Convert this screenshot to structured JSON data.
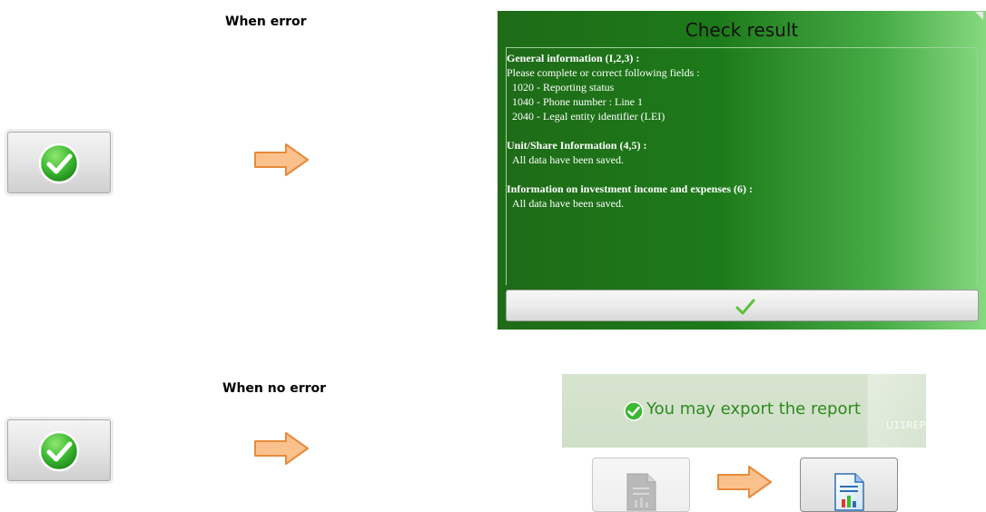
{
  "error_case": {
    "heading": "When error"
  },
  "no_error_case": {
    "heading": "When no error"
  },
  "check_result_dialog": {
    "title": "Check result",
    "sections": [
      {
        "title": "General information (I,2,3) :",
        "intro": "Please complete or correct following fields :",
        "items": [
          "1020 - Reporting status",
          "1040 - Phone number : Line 1",
          "2040 - Legal entity identifier (LEI)"
        ]
      },
      {
        "title": "Unit/Share Information (4,5) :",
        "items": [
          "All data have been saved."
        ]
      },
      {
        "title": "Information on investment income and expenses (6) :",
        "items": [
          "All data have been saved."
        ]
      }
    ]
  },
  "export_panel": {
    "message": "You may export the report",
    "ghost_label": "U11REP"
  },
  "icons": {
    "check_button": "green-check-circle-icon",
    "arrow": "orange-right-arrow-icon",
    "ok": "green-checkmark-icon",
    "report_disabled": "greyed-report-icon",
    "report_enabled": "report-chart-icon"
  },
  "colors": {
    "arrow_fill": "#fbc18d",
    "arrow_stroke": "#e88a3a",
    "check_green": "#3db832",
    "dialog_green_dark": "#1e6b17",
    "dialog_green_light": "#86d97f",
    "export_text": "#2e8a1e"
  }
}
